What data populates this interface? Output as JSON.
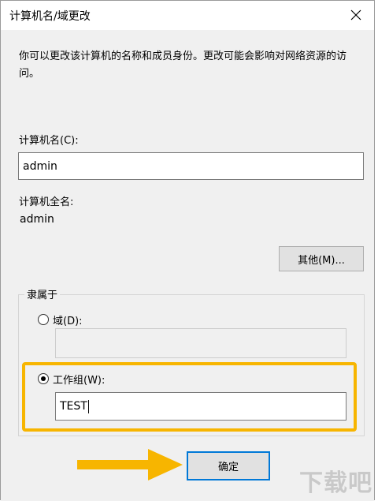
{
  "window": {
    "title": "计算机名/域更改",
    "close_icon": "close-icon"
  },
  "description": "你可以更改该计算机的名称和成员身份。更改可能会影响对网络资源的访问。",
  "computer_name": {
    "label": "计算机名(C):",
    "value": "admin"
  },
  "full_name": {
    "label": "计算机全名:",
    "value": "admin"
  },
  "more_button": {
    "label": "其他(M)..."
  },
  "member_of": {
    "legend": "隶属于",
    "domain": {
      "label": "域(D):",
      "selected": false,
      "value": ""
    },
    "workgroup": {
      "label": "工作组(W):",
      "selected": true,
      "value": "TEST"
    }
  },
  "ok_button": {
    "label": "确定"
  },
  "watermark": "下载吧",
  "colors": {
    "highlight": "#f7b500",
    "arrow": "#f7b500",
    "focus": "#0078d7"
  }
}
